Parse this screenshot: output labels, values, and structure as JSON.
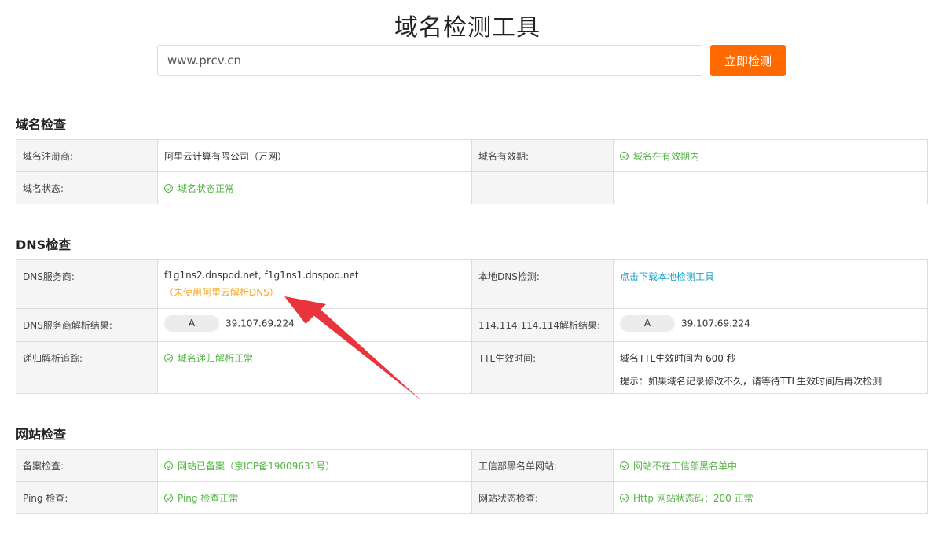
{
  "page": {
    "title": "域名检测工具"
  },
  "search": {
    "value": "www.prcv.cn",
    "button_label": "立即检测"
  },
  "domain_check": {
    "title": "域名检查",
    "registrar_label": "域名注册商:",
    "registrar_value": "阿里云计算有限公司（万网）",
    "validity_label": "域名有效期:",
    "validity_value": "域名在有效期内",
    "status_label": "域名状态:",
    "status_value": "域名状态正常"
  },
  "dns_check": {
    "title": "DNS检查",
    "provider_label": "DNS服务商:",
    "provider_value": "f1g1ns2.dnspod.net, f1g1ns1.dnspod.net",
    "provider_note": "（未使用阿里云解析DNS）",
    "local_label": "本地DNS检测:",
    "local_link": "点击下载本地检测工具",
    "provider_result_label": "DNS服务商解析结果:",
    "provider_result_type": "A",
    "provider_result_ip": "39.107.69.224",
    "public_result_label": "114.114.114.114解析结果:",
    "public_result_type": "A",
    "public_result_ip": "39.107.69.224",
    "recursive_label": "递归解析追踪:",
    "recursive_value": "域名递归解析正常",
    "ttl_label": "TTL生效时间:",
    "ttl_value": "域名TTL生效时间为 600 秒",
    "ttl_tip": "提示：如果域名记录修改不久，请等待TTL生效时间后再次检测"
  },
  "site_check": {
    "title": "网站检查",
    "icp_label": "备案检查:",
    "icp_value": "网站已备案（京ICP备19009631号）",
    "blacklist_label": "工信部黑名单网站:",
    "blacklist_value": "网站不在工信部黑名单中",
    "ping_label": "Ping 检查:",
    "ping_value": "Ping 检查正常",
    "http_label": "网站状态检查:",
    "http_value": "Http 网站状态码：200 正常"
  },
  "colors": {
    "accent": "#ff6a00",
    "ok": "#53b343",
    "warn": "#f5a623",
    "link": "#1aa0c8",
    "annotation_arrow": "#e8343a"
  },
  "icons": {
    "status_ok": "check-circle-icon",
    "annotation": "red-arrow-icon"
  }
}
